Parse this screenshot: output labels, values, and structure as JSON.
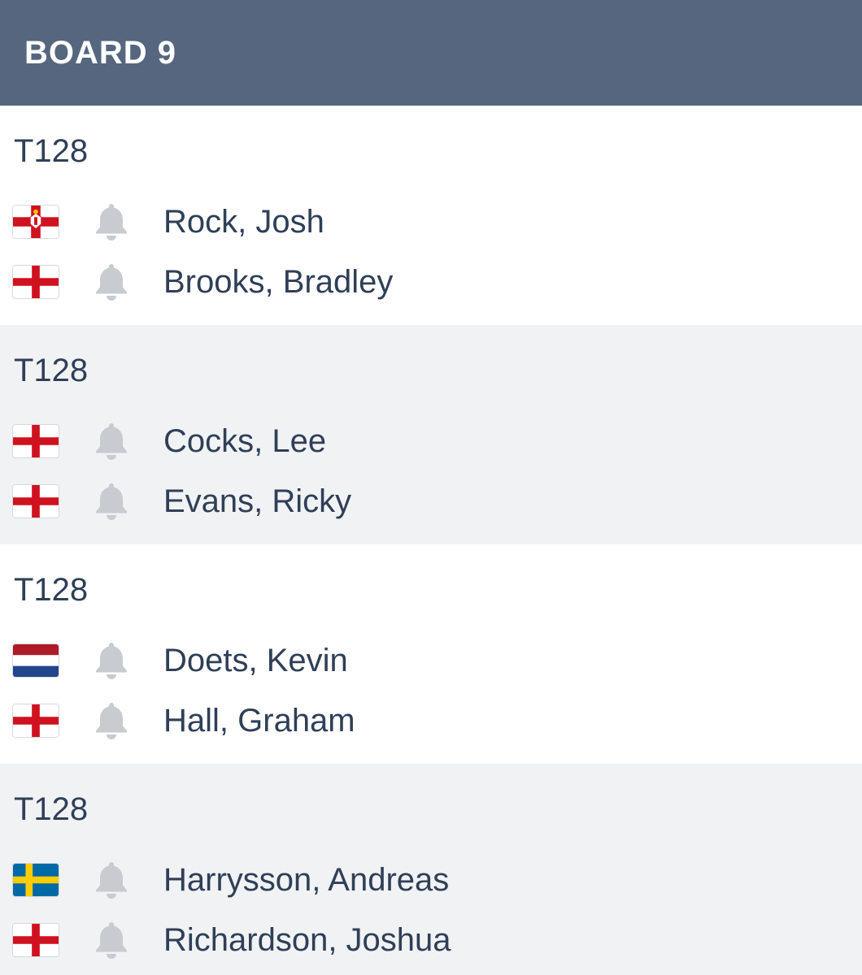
{
  "header": {
    "title": "BOARD 9"
  },
  "colors": {
    "header_bg": "#56667f",
    "text": "#2f3f57",
    "alt_row_bg": "#f1f2f4",
    "bell": "#c8cbd0"
  },
  "matches": [
    {
      "round": "T128",
      "players": [
        {
          "name": "Rock, Josh",
          "flag": "northern-ireland-flag-icon",
          "bell": "bell-icon"
        },
        {
          "name": "Brooks, Bradley",
          "flag": "england-flag-icon",
          "bell": "bell-icon"
        }
      ]
    },
    {
      "round": "T128",
      "players": [
        {
          "name": "Cocks, Lee",
          "flag": "england-flag-icon",
          "bell": "bell-icon"
        },
        {
          "name": "Evans, Ricky",
          "flag": "england-flag-icon",
          "bell": "bell-icon"
        }
      ]
    },
    {
      "round": "T128",
      "players": [
        {
          "name": "Doets, Kevin",
          "flag": "netherlands-flag-icon",
          "bell": "bell-icon"
        },
        {
          "name": "Hall, Graham",
          "flag": "england-flag-icon",
          "bell": "bell-icon"
        }
      ]
    },
    {
      "round": "T128",
      "players": [
        {
          "name": "Harrysson, Andreas",
          "flag": "sweden-flag-icon",
          "bell": "bell-icon"
        },
        {
          "name": "Richardson, Joshua",
          "flag": "england-flag-icon",
          "bell": "bell-icon"
        }
      ]
    }
  ]
}
